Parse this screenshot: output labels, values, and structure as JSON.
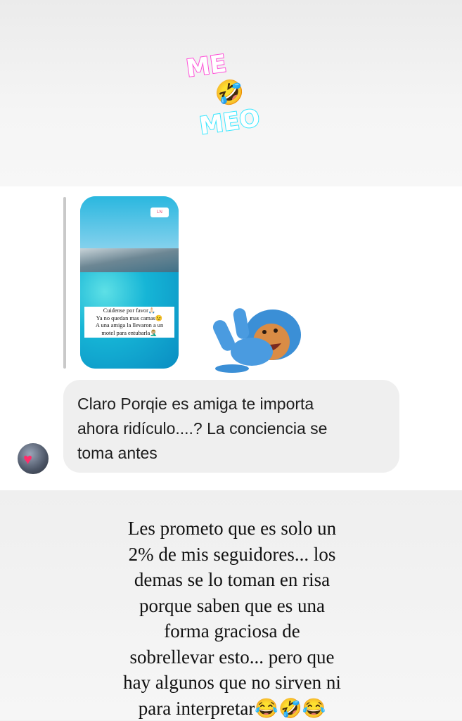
{
  "sticker": {
    "line1": "ME",
    "line2": "MEO",
    "emoji": "🤣"
  },
  "story": {
    "logo": "LN",
    "caption_lines": [
      "Cuidense por favor🙏🏻",
      "Ya no quedan mas camas😉",
      "A una amiga la llevaron a un",
      "motel para entubarla🤦🏼‍♂️"
    ]
  },
  "reply_message": {
    "lines": [
      "Claro Porqie es amiga te importa",
      "ahora ridículo....? La conciencia se",
      "toma antes"
    ]
  },
  "bottom_caption": {
    "lines": [
      "Les prometo que es solo un",
      "2% de mis seguidores... los",
      "demas se lo toman en risa",
      "porque saben que es una",
      "forma graciosa de",
      "sobrellevar esto... pero que",
      "hay algunos que no sirven ni",
      "para interpretar😂🤣😂"
    ]
  },
  "colors": {
    "bubble": "#efefef",
    "sticker_pink": "#ff4fd8",
    "sticker_cyan": "#3be7ff"
  }
}
